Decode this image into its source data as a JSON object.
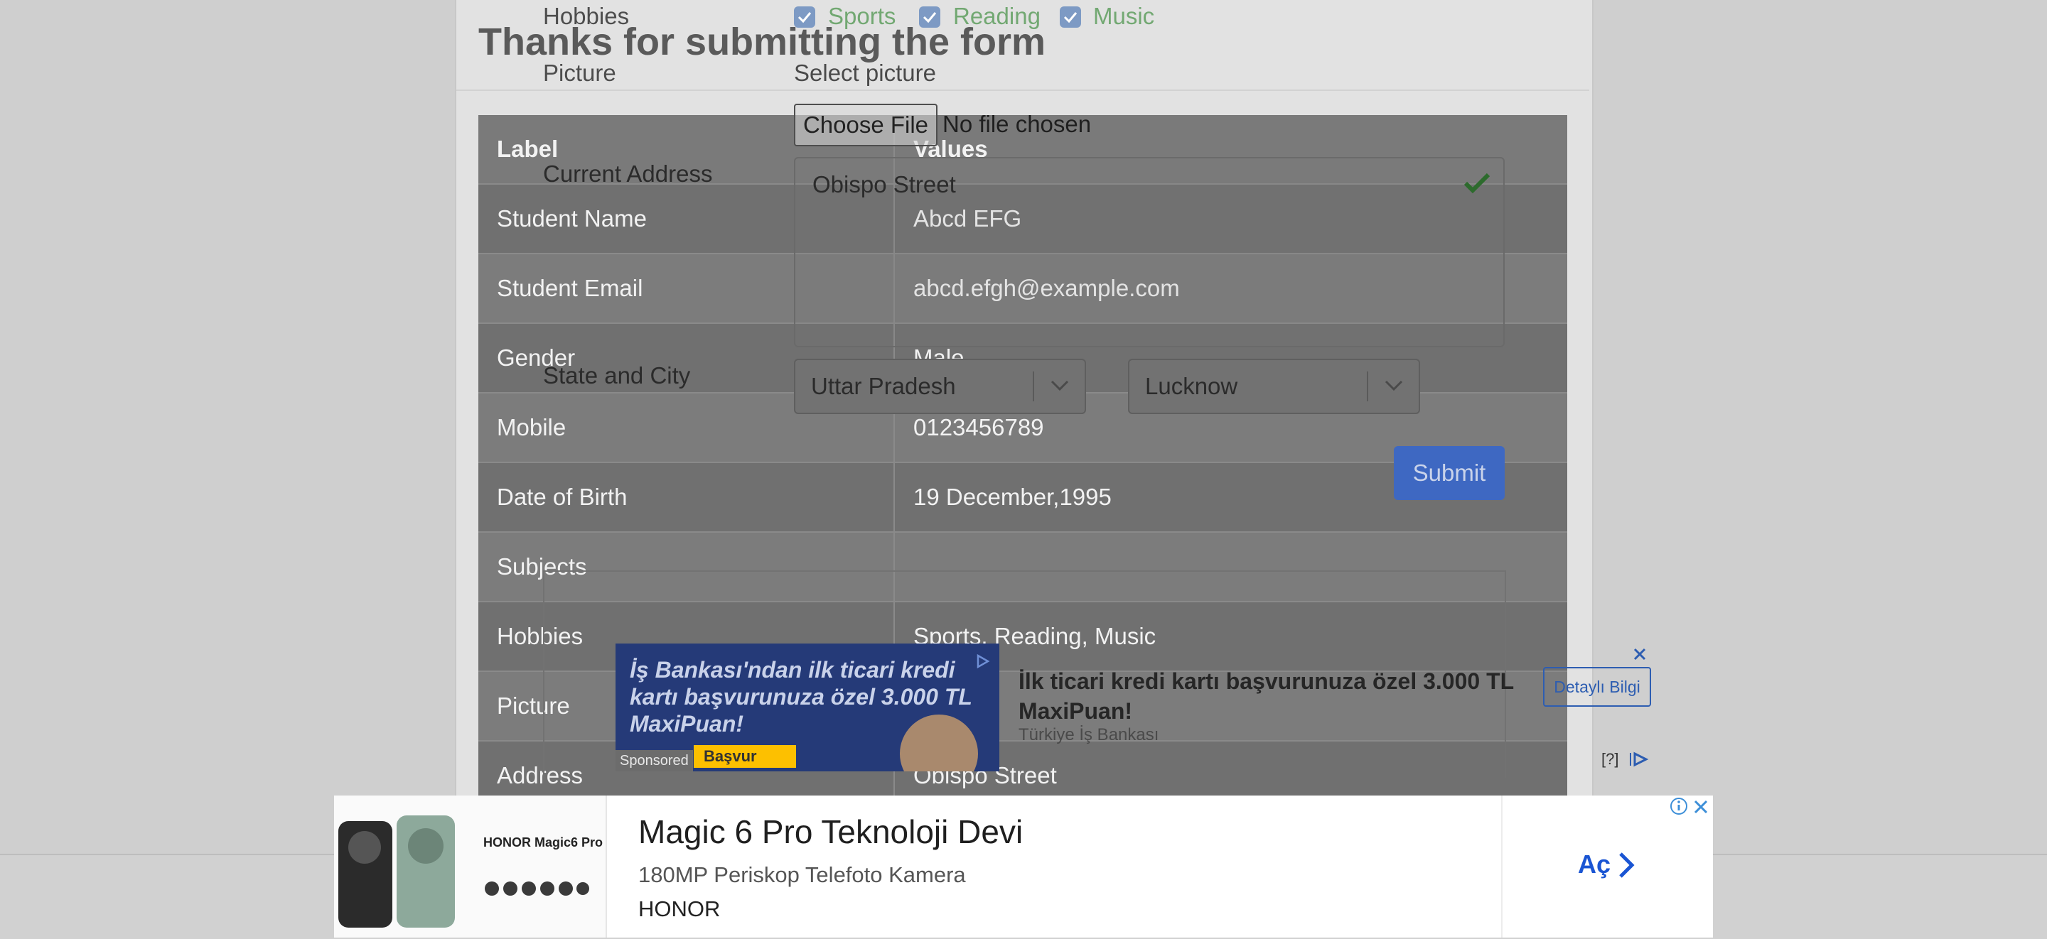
{
  "modal": {
    "title": "Thanks for submitting the form",
    "table": {
      "headers": [
        "Label",
        "Values"
      ],
      "rows": [
        {
          "label": "Student Name",
          "value": "Abcd EFG"
        },
        {
          "label": "Student Email",
          "value": "abcd.efgh@example.com"
        },
        {
          "label": "Gender",
          "value": "Male"
        },
        {
          "label": "Mobile",
          "value": "0123456789"
        },
        {
          "label": "Date of Birth",
          "value": "19 December,1995"
        },
        {
          "label": "Subjects",
          "value": ""
        },
        {
          "label": "Hobbies",
          "value": "Sports, Reading, Music"
        },
        {
          "label": "Picture",
          "value": ""
        },
        {
          "label": "Address",
          "value": "Obispo Street"
        }
      ]
    }
  },
  "form": {
    "hobbies_label": "Hobbies",
    "hobbies": [
      "Sports",
      "Reading",
      "Music"
    ],
    "picture_label": "Picture",
    "select_picture": "Select picture",
    "choose_file": "Choose File",
    "no_file": "No file chosen",
    "address_label": "Current Address",
    "address_value": "Obispo Street",
    "state_city_label": "State and City",
    "state_value": "Uttar Pradesh",
    "city_value": "Lucknow",
    "submit_label": "Submit"
  },
  "ad_mid": {
    "image_headline": "İş Bankası'ndan ilk ticari kredi kartı başvurunuza özel 3.000 TL MaxiPuan!",
    "image_button": "Başvur",
    "sponsored": "Sponsored",
    "title": "İlk ticari kredi kartı başvurunuza özel 3.000 TL MaxiPuan!",
    "advertiser": "Türkiye İş Bankası",
    "cta": "Detaylı Bilgi",
    "help": "[?]"
  },
  "ad_bottom": {
    "brand": "HONOR Magic6 Pro",
    "title": "Magic 6 Pro Teknoloji Devi",
    "description": "180MP Periskop Telefoto Kamera",
    "advertiser": "HONOR",
    "cta": "Aç"
  },
  "colors": {
    "overlay_row_dark": "#707070",
    "overlay_row_light": "#7c7c7c",
    "hobby_green": "#72a872",
    "submit_blue": "#3e68c2",
    "ad_link_blue": "#1a55d3"
  }
}
